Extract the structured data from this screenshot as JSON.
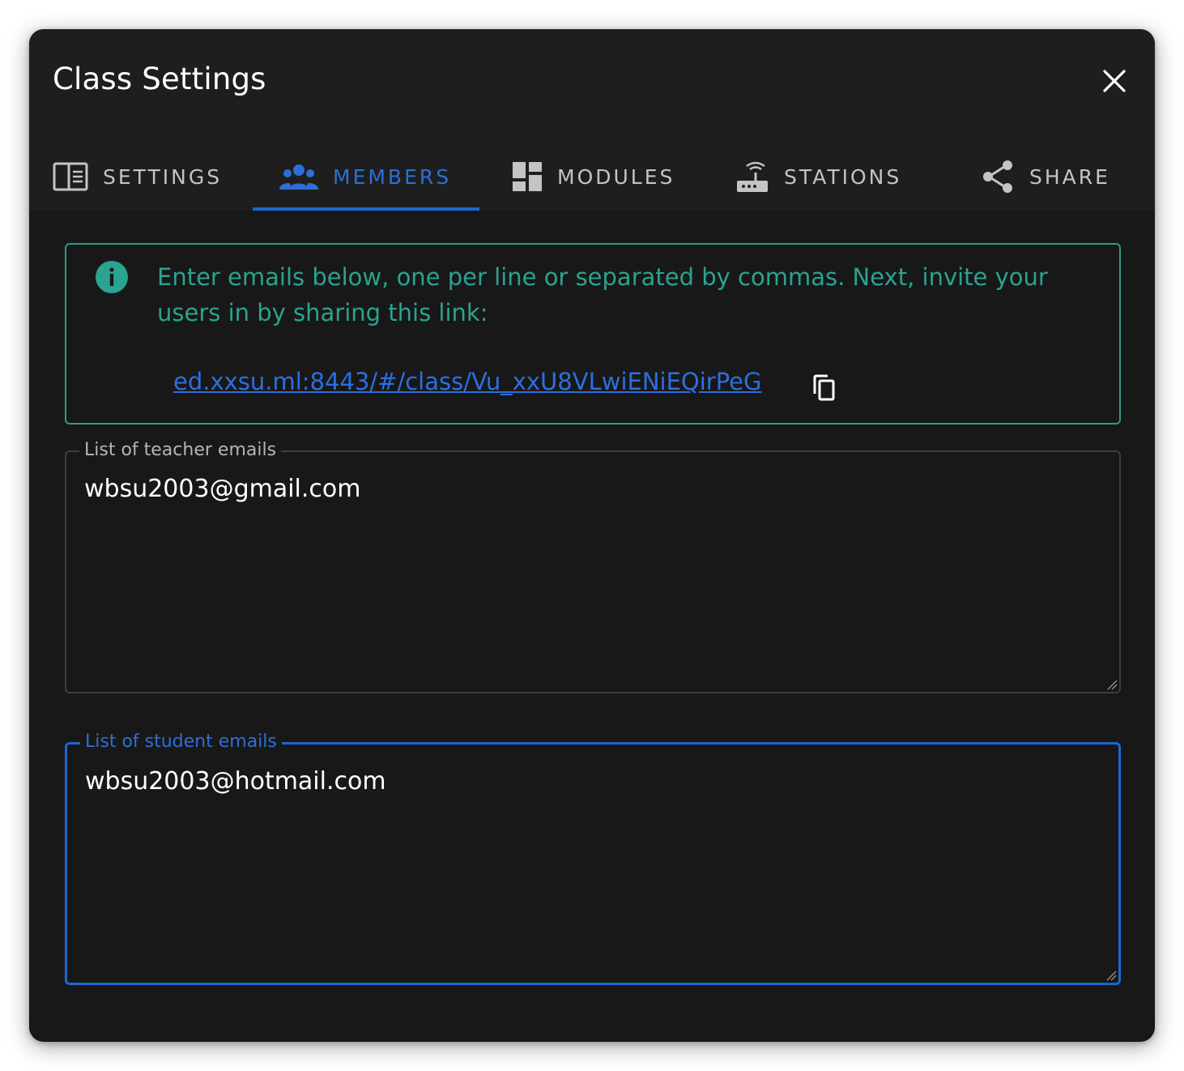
{
  "dialog": {
    "title": "Class Settings",
    "close_icon": "close-icon"
  },
  "tabs": [
    {
      "label": "SETTINGS",
      "icon": "settings-panel-icon",
      "active": false
    },
    {
      "label": "MEMBERS",
      "icon": "people-icon",
      "active": true
    },
    {
      "label": "MODULES",
      "icon": "dashboard-icon",
      "active": false
    },
    {
      "label": "STATIONS",
      "icon": "router-icon",
      "active": false
    },
    {
      "label": "SHARE",
      "icon": "share-icon",
      "active": false
    }
  ],
  "info": {
    "message": "Enter emails below, one per line or separated by commas. Next, invite your users in by sharing this link:",
    "link": "ed.xxsu.ml:8443/#/class/Vu_xxU8VLwiENiEQirPeG",
    "icon": "info-icon",
    "copy_icon": "copy-icon"
  },
  "teacher_field": {
    "label": "List of teacher emails",
    "value": "wbsu2003@gmail.com"
  },
  "student_field": {
    "label": "List of student emails",
    "value": "wbsu2003@hotmail.com",
    "focused": true
  },
  "colors": {
    "accent": "#1f66d1",
    "info": "#2a9d8a",
    "background": "#181818",
    "header": "#1e1e1e"
  }
}
